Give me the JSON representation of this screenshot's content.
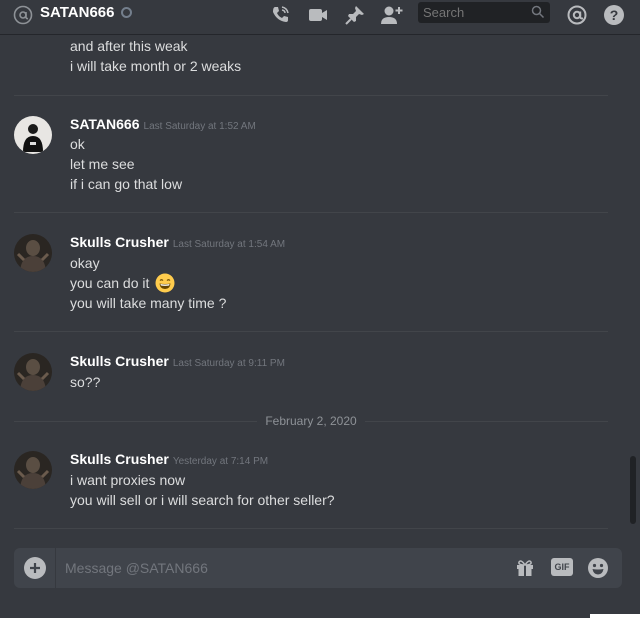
{
  "header": {
    "title": "SATAN666",
    "search_placeholder": "Search"
  },
  "messages": [
    {
      "continued": true,
      "lines": [
        "and after this weak",
        "i will take month or 2 weaks"
      ]
    },
    {
      "author": "SATAN666",
      "timestamp": "Last Saturday at 1:52 AM",
      "avatar": "satan666-avatar",
      "lines": [
        "ok",
        "let me see",
        "if i can go that low"
      ]
    },
    {
      "author": "Skulls Crusher",
      "timestamp": "Last Saturday at 1:54 AM",
      "avatar": "skulls-crusher-avatar",
      "lines": [
        "okay",
        "you can do it",
        "you will take many time ?"
      ],
      "emoji": "grinning-face-emoji"
    },
    {
      "author": "Skulls Crusher",
      "timestamp": "Last Saturday at 9:11 PM",
      "avatar": "skulls-crusher-avatar",
      "lines": [
        "so??"
      ]
    },
    {
      "date_separator": "February 2, 2020"
    },
    {
      "author": "Skulls Crusher",
      "timestamp": "Yesterday at 7:14 PM",
      "avatar": "skulls-crusher-avatar",
      "lines": [
        "i want proxies now",
        "you will sell or i will search for other seller?"
      ]
    }
  ],
  "composer": {
    "placeholder": "Message @SATAN666",
    "gif_label": "GIF"
  },
  "colors": {
    "background": "#36393f",
    "composer": "#40444b",
    "text": "#dcddde",
    "muted": "#72767d"
  }
}
